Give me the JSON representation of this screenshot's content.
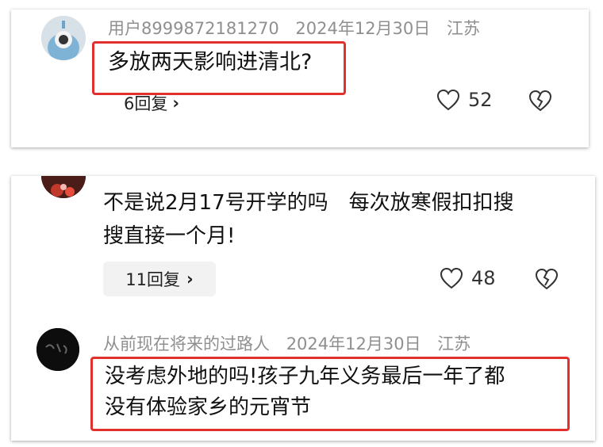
{
  "card1": {
    "username": "用户8999872181270",
    "date": "2024年12月30日",
    "location": "江苏",
    "comment": "多放两天影响进清北?",
    "replies": "6回复",
    "likes": "52",
    "chevron": "›"
  },
  "card2": {
    "comment_line1": "不是说2月17号开学的吗　每次放寒假扣扣搜",
    "comment_line2": "搜直接一个月!",
    "replies": "11回复",
    "likes": "48",
    "reply2": {
      "username": "从前现在将来的过路人",
      "date": "2024年12月30日",
      "location": "江苏",
      "comment_line1": "没考虑外地的吗!孩子九年义务最后一年了都",
      "comment_line2": "没有体验家乡的元宵节"
    }
  },
  "colors": {
    "highlight": "#e0312f",
    "meta_text": "#8f8f8f",
    "reply_bg": "#f2f2f2"
  },
  "icons": [
    "heart-icon",
    "broken-heart-icon",
    "chevron-right-icon"
  ]
}
